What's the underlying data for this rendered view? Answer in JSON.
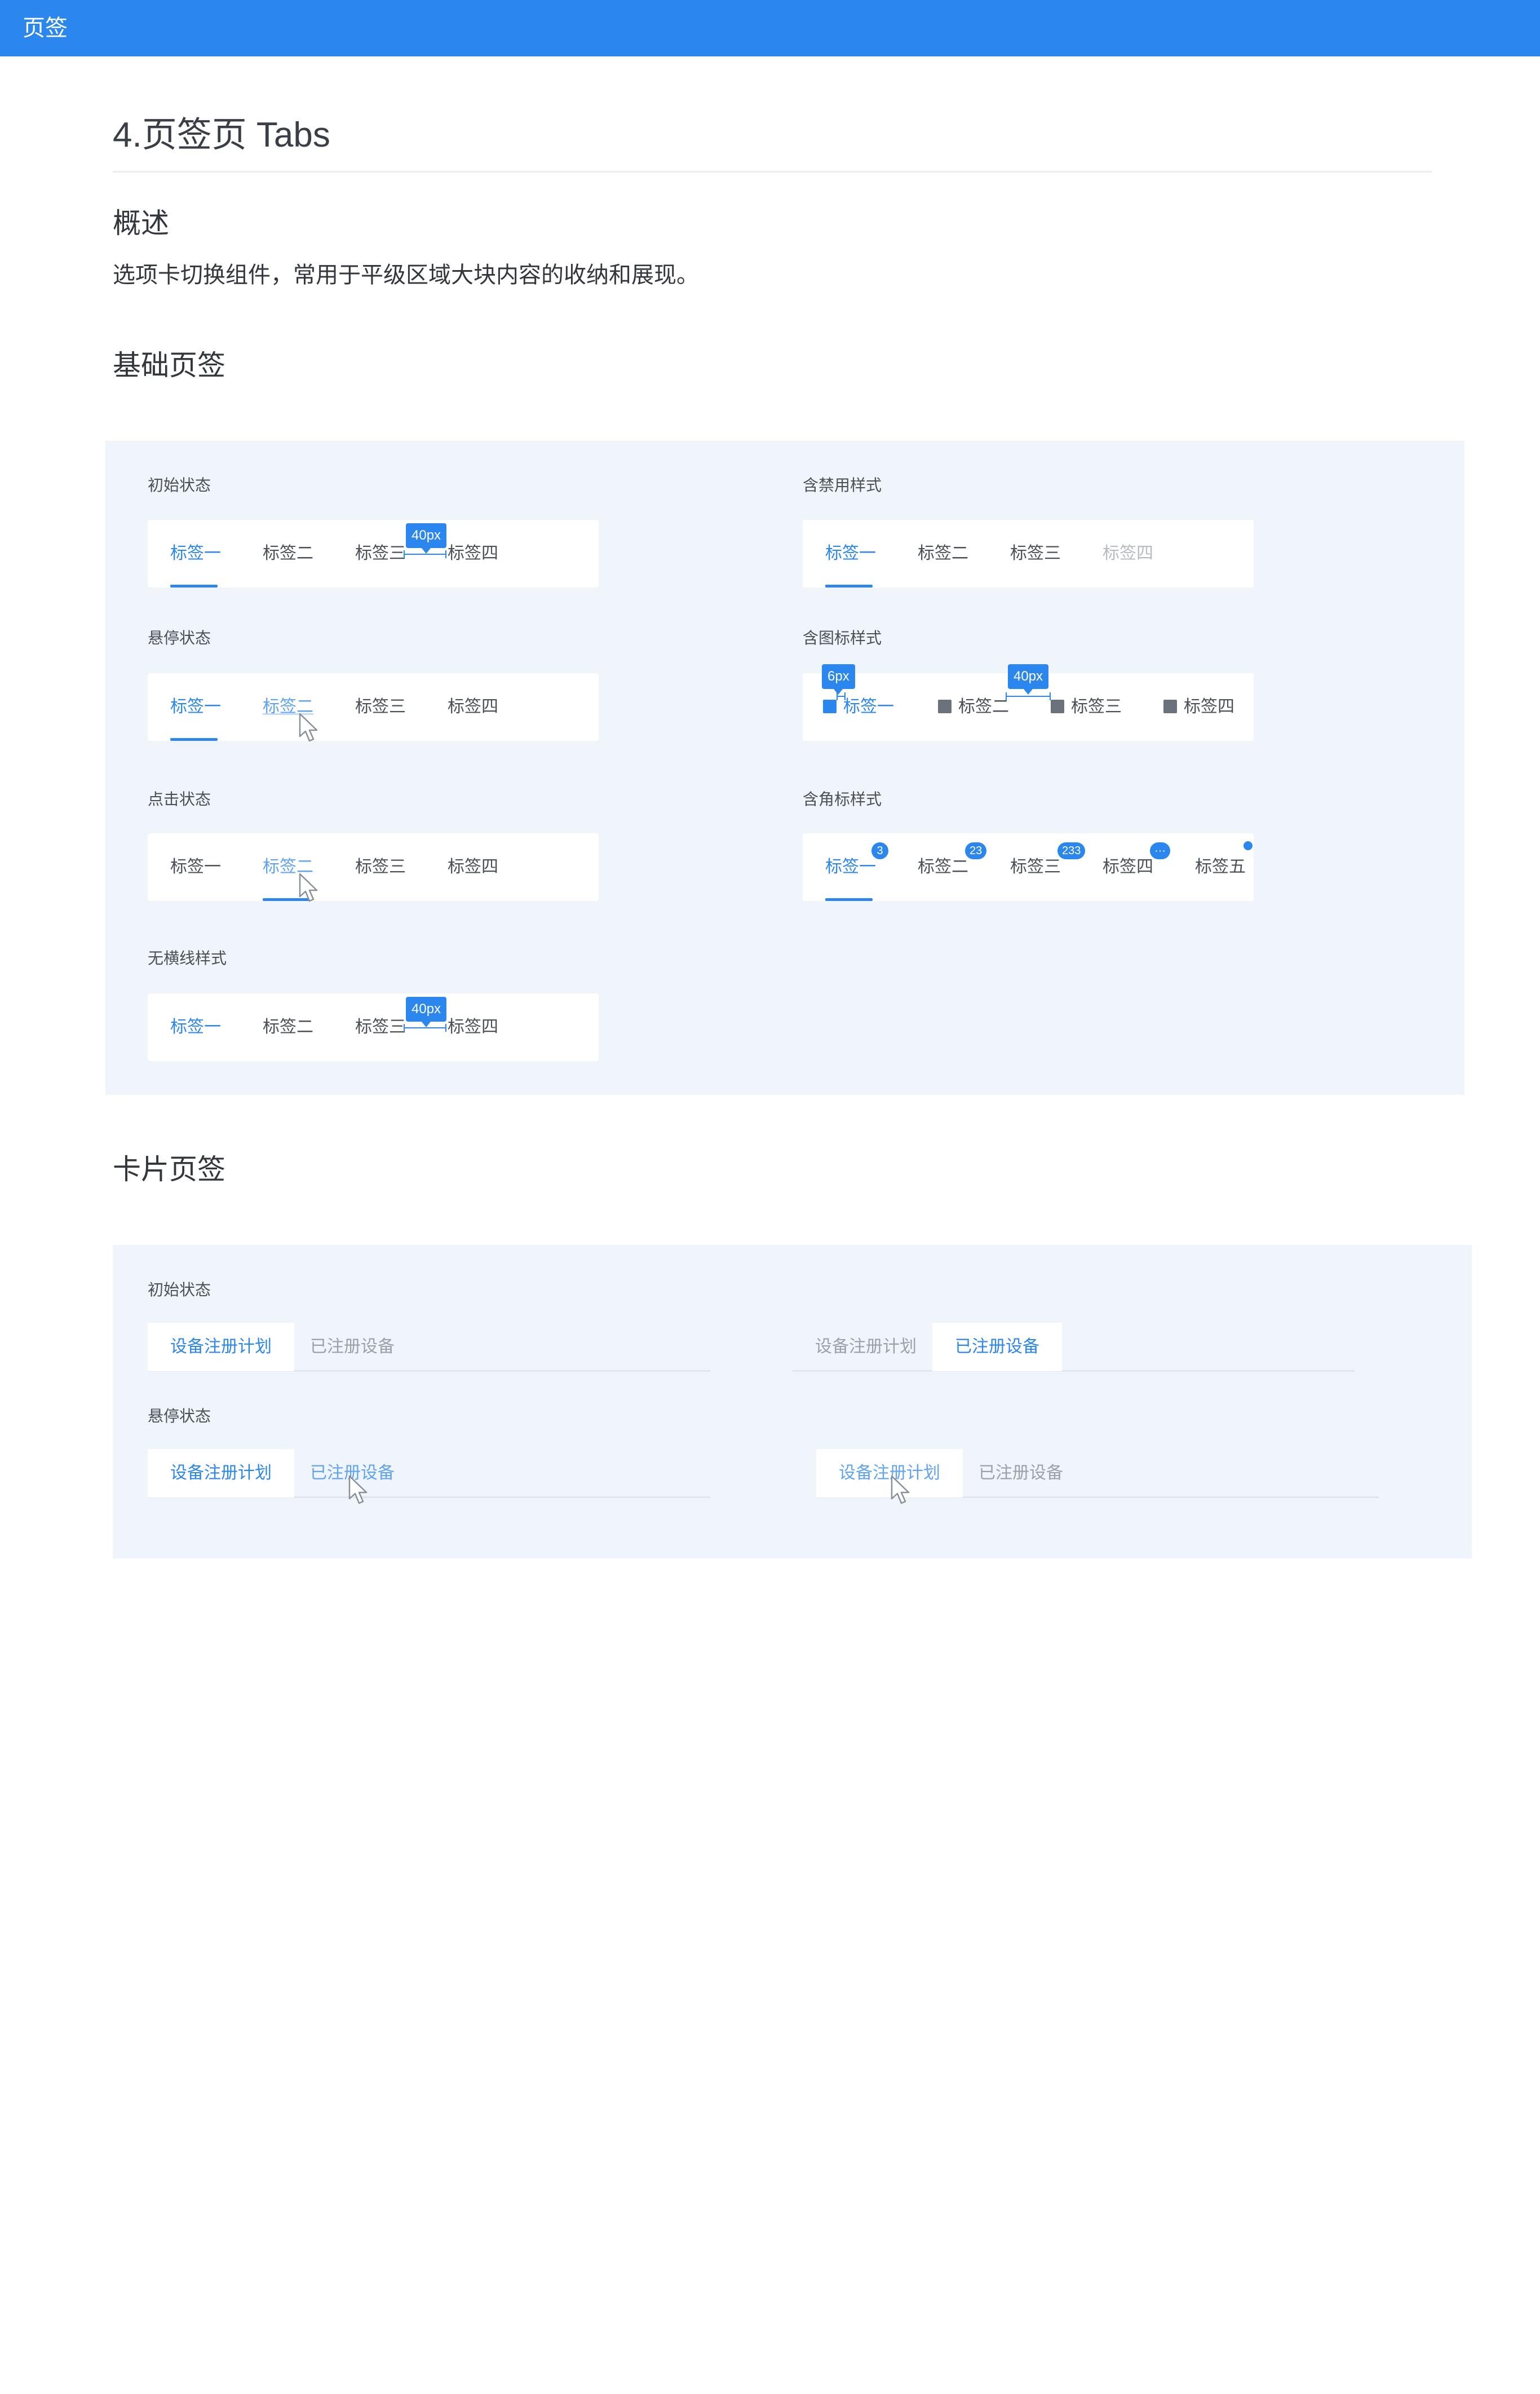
{
  "header": {
    "title": "页签"
  },
  "page": {
    "title": "4.页签页 Tabs",
    "overview_heading": "概述",
    "overview_text": "选项卡切换组件，常用于平级区域大块内容的收纳和展现。",
    "basic_heading": "基础页签",
    "card_heading": "卡片页签"
  },
  "colors": {
    "primary": "#2b87ee",
    "panel_bg": "#eff5fb",
    "text": "#33373d",
    "disabled": "#b6bcc4"
  },
  "basic": {
    "initial": {
      "label": "初始状态",
      "tabs": [
        "标签一",
        "标签二",
        "标签三",
        "标签四"
      ],
      "spacing": "40px"
    },
    "disabled": {
      "label": "含禁用样式",
      "tabs": [
        "标签一",
        "标签二",
        "标签三",
        "标签四"
      ]
    },
    "hover": {
      "label": "悬停状态",
      "tabs": [
        "标签一",
        "标签二",
        "标签三",
        "标签四"
      ]
    },
    "with_icon": {
      "label": "含图标样式",
      "tabs": [
        "标签一",
        "标签二",
        "标签三",
        "标签四"
      ],
      "icon_gap": "6px",
      "spacing": "40px"
    },
    "click": {
      "label": "点击状态",
      "tabs": [
        "标签一",
        "标签二",
        "标签三",
        "标签四"
      ]
    },
    "badge": {
      "label": "含角标样式",
      "tabs": [
        "标签一",
        "标签二",
        "标签三",
        "标签四",
        "标签五"
      ],
      "counts": [
        "3",
        "23",
        "233",
        "···"
      ]
    },
    "no_line": {
      "label": "无横线样式",
      "tabs": [
        "标签一",
        "标签二",
        "标签三",
        "标签四"
      ],
      "spacing": "40px"
    }
  },
  "card": {
    "initial": {
      "label": "初始状态"
    },
    "hover": {
      "label": "悬停状态"
    },
    "tabs": [
      "设备注册计划",
      "已注册设备"
    ]
  }
}
